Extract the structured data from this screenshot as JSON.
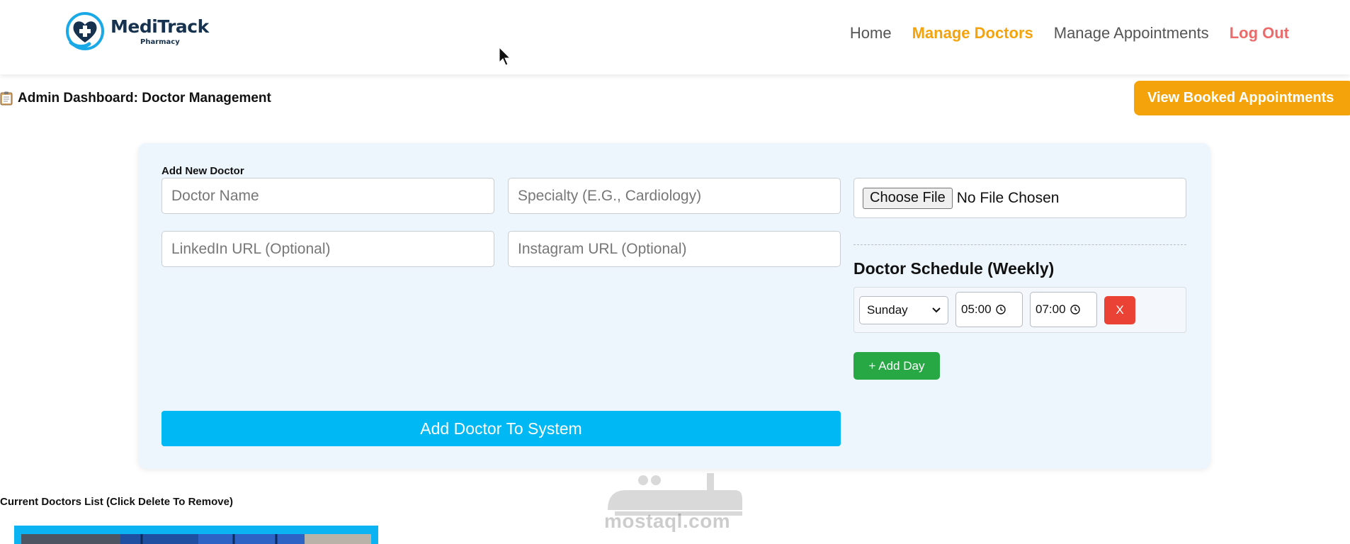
{
  "header": {
    "brand_title": "MediTrack",
    "brand_subtitle": "Pharmacy",
    "nav": {
      "home": "Home",
      "manage_doctors": "Manage Doctors",
      "manage_appointments": "Manage Appointments",
      "logout": "Log Out"
    }
  },
  "dashboard": {
    "title": "Admin Dashboard: Doctor Management",
    "view_button": "View Booked Appointments"
  },
  "form": {
    "section_label": "Add New Doctor",
    "name_placeholder": "Doctor Name",
    "specialty_placeholder": "Specialty (E.G., Cardiology)",
    "linkedin_placeholder": "LinkedIn URL (Optional)",
    "instagram_placeholder": "Instagram URL (Optional)",
    "file_button": "Choose File",
    "file_status": "No File Chosen",
    "schedule_title": "Doctor Schedule (Weekly)",
    "schedule_rows": [
      {
        "day": "Sunday",
        "start": "05:00",
        "end": "07:00",
        "remove_label": "X"
      }
    ],
    "add_day_label": "+ Add Day",
    "submit_label": "Add Doctor To System"
  },
  "list": {
    "title": "Current Doctors List (Click Delete To Remove)"
  },
  "watermark": {
    "latin": "mostaql.com"
  },
  "colors": {
    "accent_orange": "#f5a30a",
    "logout_red": "#ec6a6a",
    "primary_blue": "#00b8f4",
    "success_green": "#28a745",
    "danger_red": "#ea4335",
    "panel_bg": "#eef6fd",
    "brand_navy": "#16324f"
  }
}
